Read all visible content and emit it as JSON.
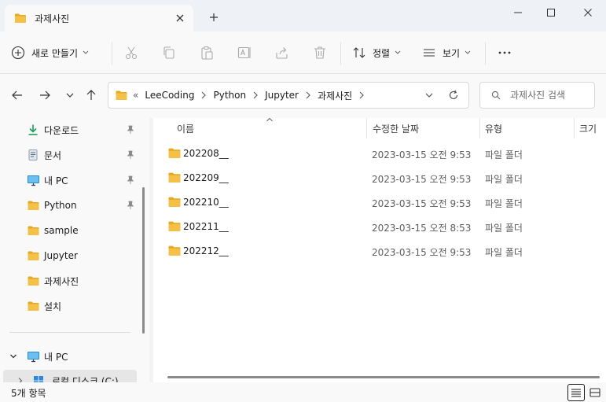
{
  "window": {
    "tab_title": "과제사진",
    "colors": {
      "folder": "#f4c048",
      "folder_dark": "#e8a820",
      "accent": "#0067c0",
      "download": "#1b9e5a",
      "pc": "#2b88d8"
    }
  },
  "commands": {
    "new_label": "새로 만들기",
    "sort_label": "정렬",
    "view_label": "보기"
  },
  "address": {
    "overflow": "«",
    "breadcrumbs": [
      "LeeCoding",
      "Python",
      "Jupyter",
      "과제사진"
    ]
  },
  "search": {
    "placeholder": "과제사진 검색"
  },
  "sidebar": {
    "items": [
      {
        "label": "다운로드",
        "icon": "download-icon",
        "pinned": true
      },
      {
        "label": "문서",
        "icon": "document-icon",
        "pinned": true
      },
      {
        "label": "내 PC",
        "icon": "pc-icon",
        "pinned": true
      },
      {
        "label": "Python",
        "icon": "folder-icon",
        "pinned": true
      },
      {
        "label": "sample",
        "icon": "folder-icon",
        "pinned": false
      },
      {
        "label": "Jupyter",
        "icon": "folder-icon",
        "pinned": false
      },
      {
        "label": "과제사진",
        "icon": "folder-icon",
        "pinned": false
      },
      {
        "label": "설치",
        "icon": "folder-icon",
        "pinned": false
      }
    ],
    "tree": [
      {
        "label": "내 PC",
        "icon": "pc-icon",
        "expanded": true
      },
      {
        "label": "로컬 디스크 (C:)",
        "icon": "windows-drive-icon",
        "selected": true
      }
    ]
  },
  "columns": {
    "name": "이름",
    "date": "수정한 날짜",
    "type": "유형",
    "size": "크기"
  },
  "files": [
    {
      "name": "202208__",
      "date": "2023-03-15 오전 9:53",
      "type": "파일 폴더"
    },
    {
      "name": "202209__",
      "date": "2023-03-15 오전 9:53",
      "type": "파일 폴더"
    },
    {
      "name": "202210__",
      "date": "2023-03-15 오전 9:53",
      "type": "파일 폴더"
    },
    {
      "name": "202211__",
      "date": "2023-03-15 오전 8:53",
      "type": "파일 폴더"
    },
    {
      "name": "202212__",
      "date": "2023-03-15 오전 9:53",
      "type": "파일 폴더"
    }
  ],
  "status": {
    "item_count": "5개 항목"
  }
}
